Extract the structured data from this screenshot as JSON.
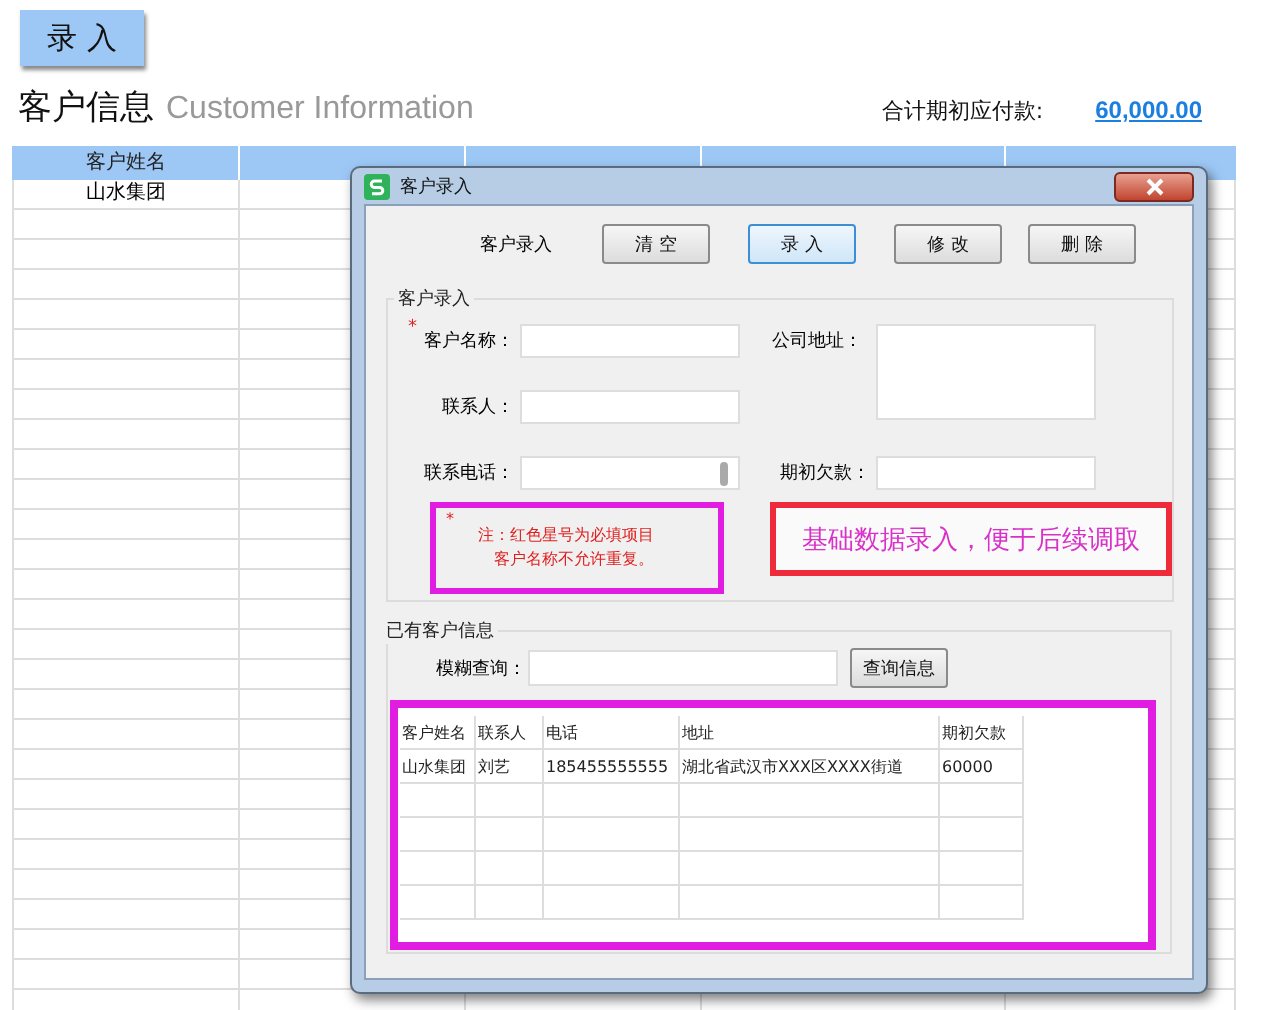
{
  "action_button": "录 入",
  "heading": {
    "title": "客户信息",
    "subtitle": "Customer Information"
  },
  "total": {
    "label": "合计期初应付款:",
    "value": "60,000.00"
  },
  "sheet": {
    "columns": [
      "客户姓名"
    ],
    "rows": [
      [
        "山水集团"
      ]
    ]
  },
  "dialog": {
    "title": "客户录入",
    "toolbar_label": "客户录入",
    "buttons": [
      {
        "label": "清 空",
        "selected": false
      },
      {
        "label": "录 入",
        "selected": true
      },
      {
        "label": "修 改",
        "selected": false
      },
      {
        "label": "删 除",
        "selected": false
      }
    ],
    "entry_group": {
      "title": "客户录入",
      "fields": [
        {
          "label": "客户名称：",
          "required": true,
          "kind": "input"
        },
        {
          "label": "公司地址：",
          "required": false,
          "kind": "textarea"
        },
        {
          "label": "联系人：",
          "required": false,
          "kind": "input"
        },
        {
          "label": "联系电话：",
          "required": false,
          "kind": "scroll-input"
        },
        {
          "label": "期初欠款：",
          "required": false,
          "kind": "input"
        }
      ],
      "note": {
        "mark": "*",
        "lines": [
          "注：红色星号为必填项目",
          "客户名称不允许重复。"
        ]
      },
      "banner": "基础数据录入，便于后续调取"
    },
    "query_group": {
      "title": "已有客户信息",
      "search_label": "模糊查询：",
      "search_button": "查询信息",
      "table": {
        "columns": [
          "客户姓名",
          "联系人",
          "电话",
          "地址",
          "期初欠款"
        ],
        "rows": [
          [
            "山水集团",
            "刘艺",
            "185455555555",
            "湖北省武汉市XXX区XXXX街道",
            "60000"
          ]
        ]
      }
    }
  }
}
